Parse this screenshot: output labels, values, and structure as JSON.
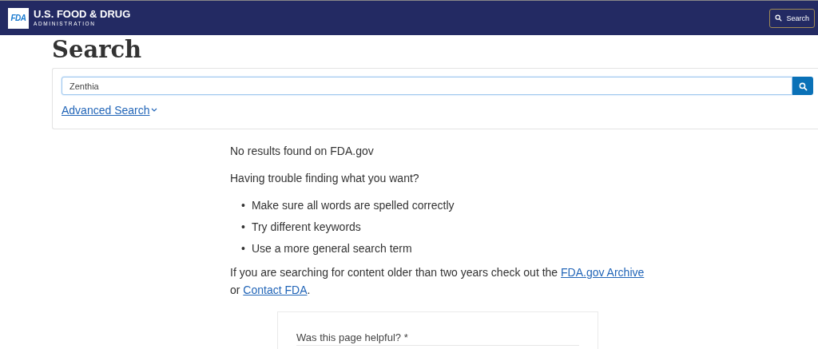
{
  "header": {
    "logo": "FDA",
    "agency_name": "U.S. FOOD & DRUG",
    "agency_subtitle": "ADMINISTRATION",
    "search_button": "Search"
  },
  "page_title": "Search",
  "search": {
    "value": "Zenthia",
    "advanced_link": "Advanced Search"
  },
  "results": {
    "message": "No results found on FDA.gov",
    "help_heading": "Having trouble finding what you want?",
    "tips": [
      {
        "marker": "•",
        "text": "Make sure all words are spelled correctly"
      },
      {
        "marker": "•",
        "text": "Try different keywords"
      },
      {
        "marker": "•",
        "text": "Use a more general search term"
      }
    ],
    "archive_note": [
      {
        "kind": "text",
        "text": "If you are searching for content older than two years check out the "
      },
      {
        "kind": "link",
        "text": "FDA.gov Archive"
      },
      {
        "kind": "text",
        "text": " or "
      },
      {
        "kind": "link",
        "text": "Contact FDA"
      },
      {
        "kind": "text",
        "text": "."
      }
    ]
  },
  "feedback": {
    "question": "Was this page helpful? *"
  }
}
